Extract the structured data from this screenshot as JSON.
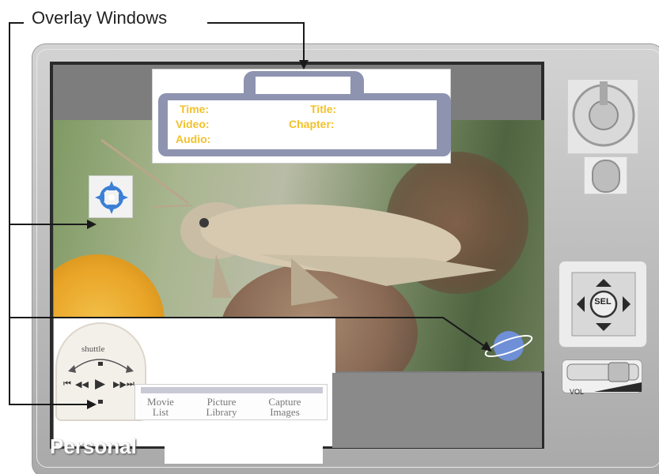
{
  "callout": {
    "title": "Overlay Windows"
  },
  "info_window": {
    "time_label": "Time:",
    "title_label": "Title:",
    "video_label": "Video:",
    "chapter_label": "Chapter:",
    "audio_label": "Audio:"
  },
  "controls": {
    "shuttle_label": "shuttle",
    "transport": [
      "⏮",
      "◀◀",
      "▶",
      "▶▶",
      "⏭"
    ],
    "menu": [
      {
        "line1": "Movie",
        "line2": "List"
      },
      {
        "line1": "Picture",
        "line2": "Library"
      },
      {
        "line1": "Capture",
        "line2": "Images"
      }
    ]
  },
  "brand": {
    "label": "Personal"
  },
  "dpad": {
    "center_label": "SEL"
  },
  "volume": {
    "label": "VOL"
  },
  "colors": {
    "accent_purple": "#8e93b0",
    "label_yellow": "#f2c12c",
    "planet_blue": "#6f8fd6"
  },
  "icons": [
    "crosshair-icon",
    "planet-icon",
    "jog-dial-icon",
    "knob-icon",
    "dpad-icon",
    "volume-slider-icon",
    "shuttle-dial-icon"
  ]
}
